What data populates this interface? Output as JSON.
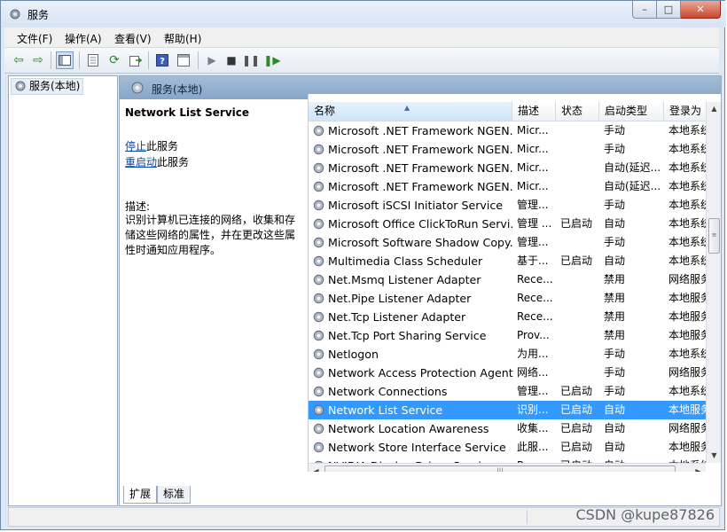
{
  "window": {
    "title": "服务"
  },
  "menu": [
    "文件(F)",
    "操作(A)",
    "查看(V)",
    "帮助(H)"
  ],
  "tree": {
    "root": "服务(本地)"
  },
  "header": {
    "label": "服务(本地)"
  },
  "detail": {
    "service_name": "Network List Service",
    "stop_link": "停止",
    "stop_suffix": "此服务",
    "restart_link": "重启动",
    "restart_suffix": "此服务",
    "desc_label": "描述:",
    "desc_text": "识别计算机已连接的网络，收集和存储这些网络的属性，并在更改这些属性时通知应用程序。"
  },
  "columns": [
    "名称",
    "描述",
    "状态",
    "启动类型",
    "登录为"
  ],
  "rows": [
    {
      "name": "Microsoft .NET Framework NGEN...",
      "desc": "Micr...",
      "status": "",
      "startup": "手动",
      "logon": "本地系统"
    },
    {
      "name": "Microsoft .NET Framework NGEN...",
      "desc": "Micr...",
      "status": "",
      "startup": "手动",
      "logon": "本地系统"
    },
    {
      "name": "Microsoft .NET Framework NGEN...",
      "desc": "Micr...",
      "status": "",
      "startup": "自动(延迟...",
      "logon": "本地系统"
    },
    {
      "name": "Microsoft .NET Framework NGEN...",
      "desc": "Micr...",
      "status": "",
      "startup": "自动(延迟...",
      "logon": "本地系统"
    },
    {
      "name": "Microsoft iSCSI Initiator Service",
      "desc": "管理...",
      "status": "",
      "startup": "手动",
      "logon": "本地系统"
    },
    {
      "name": "Microsoft Office ClickToRun Servi...",
      "desc": "管理 ...",
      "status": "已启动",
      "startup": "自动",
      "logon": "本地系统"
    },
    {
      "name": "Microsoft Software Shadow Copy...",
      "desc": "管理...",
      "status": "",
      "startup": "手动",
      "logon": "本地系统"
    },
    {
      "name": "Multimedia Class Scheduler",
      "desc": "基于...",
      "status": "已启动",
      "startup": "自动",
      "logon": "本地系统"
    },
    {
      "name": "Net.Msmq Listener Adapter",
      "desc": "Rece...",
      "status": "",
      "startup": "禁用",
      "logon": "网络服务"
    },
    {
      "name": "Net.Pipe Listener Adapter",
      "desc": "Rece...",
      "status": "",
      "startup": "禁用",
      "logon": "本地服务"
    },
    {
      "name": "Net.Tcp Listener Adapter",
      "desc": "Rece...",
      "status": "",
      "startup": "禁用",
      "logon": "本地服务"
    },
    {
      "name": "Net.Tcp Port Sharing Service",
      "desc": "Prov...",
      "status": "",
      "startup": "禁用",
      "logon": "本地服务"
    },
    {
      "name": "Netlogon",
      "desc": "为用...",
      "status": "",
      "startup": "手动",
      "logon": "本地系统"
    },
    {
      "name": "Network Access Protection Agent",
      "desc": "网络...",
      "status": "",
      "startup": "手动",
      "logon": "网络服务"
    },
    {
      "name": "Network Connections",
      "desc": "管理...",
      "status": "已启动",
      "startup": "手动",
      "logon": "本地系统"
    },
    {
      "name": "Network List Service",
      "desc": "识别...",
      "status": "已启动",
      "startup": "自动",
      "logon": "本地服务"
    },
    {
      "name": "Network Location Awareness",
      "desc": "收集...",
      "status": "已启动",
      "startup": "自动",
      "logon": "网络服务"
    },
    {
      "name": "Network Store Interface Service",
      "desc": "此服...",
      "status": "已启动",
      "startup": "自动",
      "logon": "本地服务"
    },
    {
      "name": "NVIDIA Display Driver Service",
      "desc": "Prov...",
      "status": "已启动",
      "startup": "自动",
      "logon": "本地系统"
    }
  ],
  "selected_row": 15,
  "tabs": [
    "扩展",
    "标准"
  ],
  "watermark": "CSDN @kupe87826",
  "colors": {
    "selection": "#3399ff",
    "header_band": "#a4bdd8",
    "link": "#0645ad"
  }
}
